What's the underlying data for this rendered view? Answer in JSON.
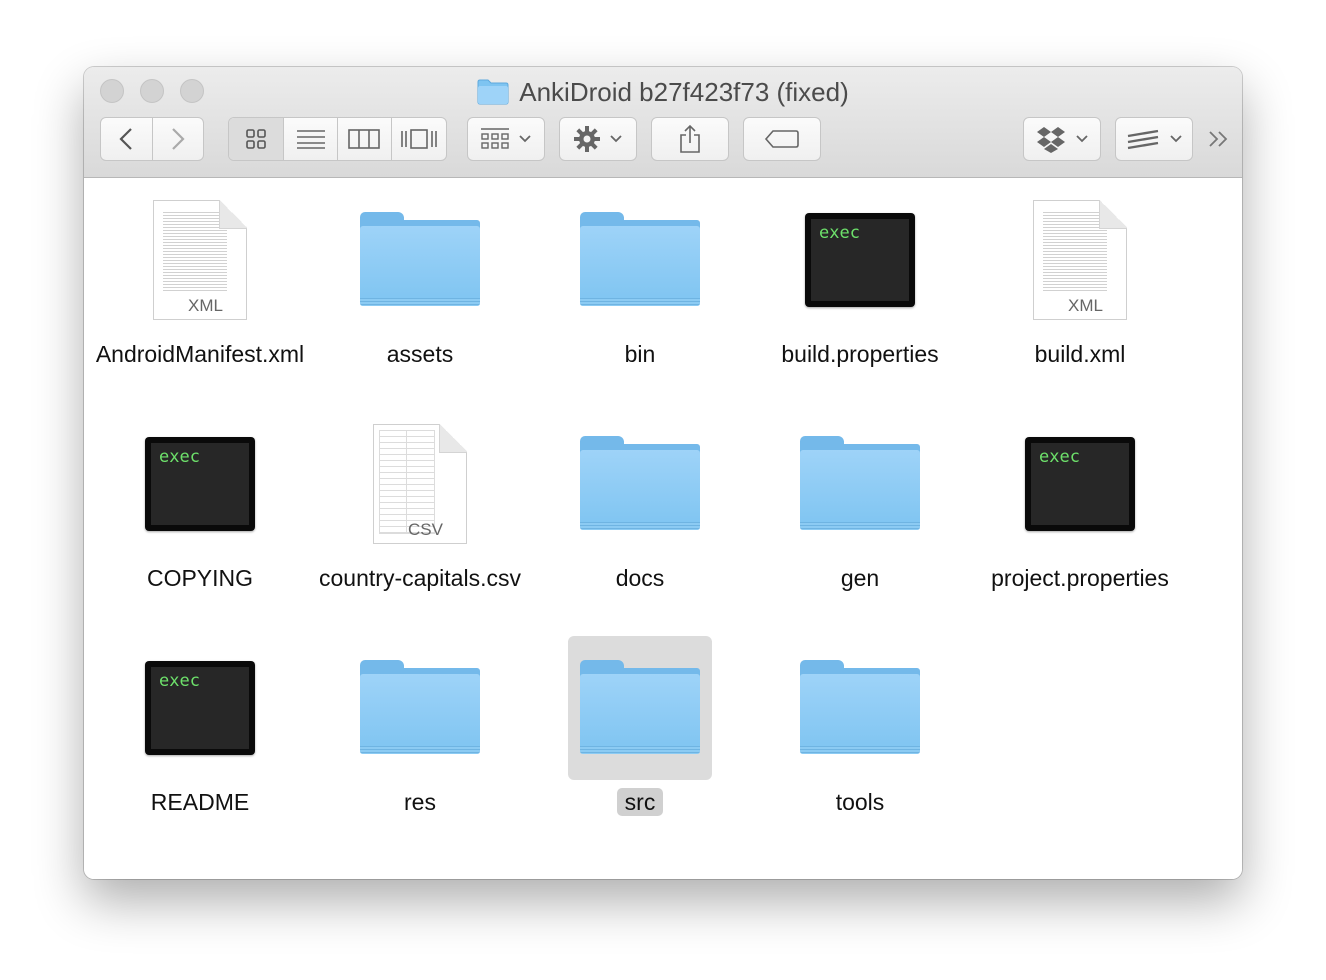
{
  "window": {
    "title": "AnkiDroid b27f423f73 (fixed)"
  },
  "toolbar": {
    "icons": [
      "back-icon",
      "forward-icon",
      "icon-view-icon",
      "list-view-icon",
      "column-view-icon",
      "cover-flow-icon",
      "arrange-icon",
      "action-gear-icon",
      "share-icon",
      "tag-icon",
      "dropbox-icon",
      "sourcetree-icon",
      "overflow-icon"
    ]
  },
  "colors": {
    "folder": "#7ec4f1",
    "exec_text": "#6de16b",
    "selection": "#dcdcdc"
  },
  "files": [
    {
      "name": "AndroidManifest.xml",
      "kind": "xml",
      "ext": "XML"
    },
    {
      "name": "assets",
      "kind": "folder"
    },
    {
      "name": "bin",
      "kind": "folder"
    },
    {
      "name": "build.properties",
      "kind": "exec",
      "badge": "exec"
    },
    {
      "name": "build.xml",
      "kind": "xml",
      "ext": "XML"
    },
    {
      "name": "COPYING",
      "kind": "exec",
      "badge": "exec"
    },
    {
      "name": "country-capitals.csv",
      "kind": "csv",
      "ext": "CSV"
    },
    {
      "name": "docs",
      "kind": "folder"
    },
    {
      "name": "gen",
      "kind": "folder"
    },
    {
      "name": "project.properties",
      "kind": "exec",
      "badge": "exec"
    },
    {
      "name": "README",
      "kind": "exec",
      "badge": "exec"
    },
    {
      "name": "res",
      "kind": "folder"
    },
    {
      "name": "src",
      "kind": "folder",
      "selected": true
    },
    {
      "name": "tools",
      "kind": "folder"
    }
  ]
}
